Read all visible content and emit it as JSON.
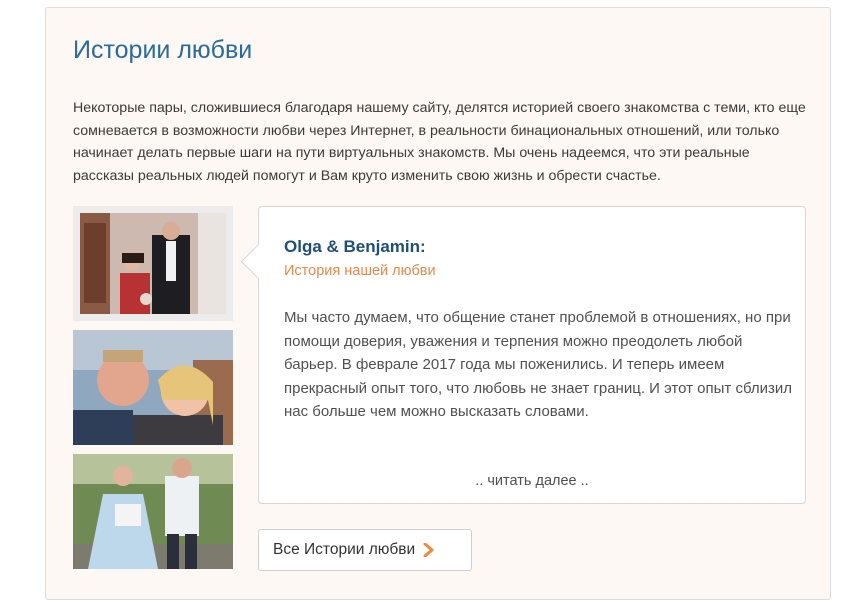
{
  "section": {
    "title": "Истории любви",
    "intro": "Некоторые пары, сложившиеся благодаря нашему сайту, делятся историей своего знакомства с теми, кто еще сомневается в возможности любви через Интернет, в реальности бинациональных отношений, или только начинает делать первые шаги на пути виртуальных знакомств. Мы очень надеемся, что эти реальные рассказы реальных людей помогут и Вам круто изменить свою жизнь и обрести счастье."
  },
  "story": {
    "names": "Olga & Benjamin:",
    "subtitle": "История нашей любви",
    "text": "Мы часто думаем, что общение станет проблемой в отношениях, но при помощи доверия, уважения и терпения можно преодолеть любой барьер. В феврале 2017 года мы поженились. И теперь имеем прекрасный опыт того, что любовь не знает границ. И этот опыт сблизил нас больше чем можно высказать словами.",
    "read_more": ".. читать далее .."
  },
  "all_stories_button": {
    "label": "Все Истории любви",
    "icon": "chevron-right-icon"
  },
  "colors": {
    "title": "#2b6a9e",
    "names": "#1f4f73",
    "subtitle": "#e48a4f",
    "panel_bg": "#fdf8f3",
    "chevron": "#f08a3c"
  }
}
